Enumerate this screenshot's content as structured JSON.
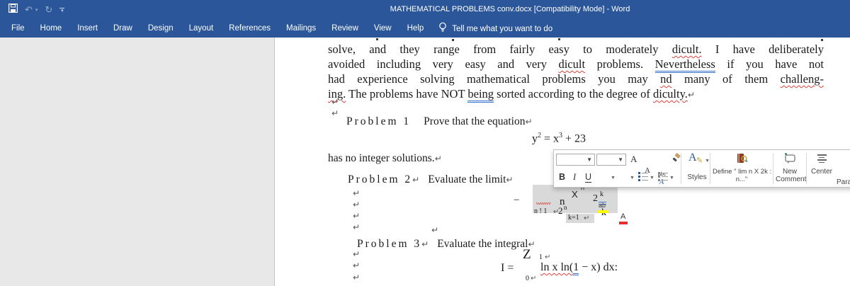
{
  "titlebar": {
    "title": "MATHEMATICAL PROBLEMS conv.docx [Compatibility Mode]  -  Word",
    "icons": {
      "undo": "↶",
      "redo": "↻",
      "caret": "▾"
    }
  },
  "ribbon": {
    "tabs": [
      "File",
      "Home",
      "Insert",
      "Draw",
      "Design",
      "Layout",
      "References",
      "Mailings",
      "Review",
      "View",
      "Help"
    ],
    "tell_me": "Tell me what you want to do"
  },
  "document": {
    "ret": "↵",
    "body": {
      "l1a": "solve, and they range from fairly easy to moderately ",
      "l1b": "dicult.",
      "l1c": " I have deliberately",
      "l2a": "avoided including very easy and very ",
      "l2b": "dicult",
      "l2c": " problems. ",
      "l2d": "Nevertheless",
      "l2e": " if you have not",
      "l3a": "had experience solving mathematical problems you may ",
      "l3b": "nd",
      "l3c": " many of them ",
      "l3d": "challeng-",
      "l4a": "ing.",
      "l4b": " The problems have NOT ",
      "l4c": "being",
      "l4d": " sorted according to the degree of ",
      "l4e": "diculty."
    },
    "p1": {
      "label": "Problem 1",
      "text": "Prove that the equation"
    },
    "eq1": {
      "v1": "y",
      "s1": "2",
      "mid": " = ",
      "v2": "x",
      "s2": "3",
      "tail": " + 23"
    },
    "p1_tail": "has no integer solutions.",
    "p2": {
      "label": "Problem 2",
      "text": "Evaluate the limit"
    },
    "math2": {
      "minus": "−",
      "n_upper": "n",
      "sigma": "X",
      "sigma_sup": "n",
      "num_base": "2",
      "num_sup": "k",
      "lim_sub": "n ! 1",
      "den2_base": "2",
      "den2_sup": "n",
      "den_k": "k",
      "k_eq": "k=1"
    },
    "p3": {
      "label": "Problem 3",
      "text": "Evaluate the integral"
    },
    "math3": {
      "z": "Z",
      "upper": "1",
      "i_eq": "I =",
      "red": "ln x ln(",
      "blue": "1",
      "rest": " − x) dx:",
      "lower": "0"
    }
  },
  "mini_toolbar": {
    "bold": "B",
    "italic": "I",
    "underline": "U",
    "highlight_ab": "ab",
    "font_color_a": "A",
    "grow_a": "A",
    "shrink_a": "A",
    "case_top": "abc",
    "case_bottom": "A",
    "styles_a": "A",
    "styles_label": "Styles",
    "define_line1": "Define \" lim n X 2k :",
    "define_line2": "n...\"",
    "new_line1": "New",
    "new_line2": "Comment",
    "center_label": "Center",
    "para_label": "Para"
  }
}
